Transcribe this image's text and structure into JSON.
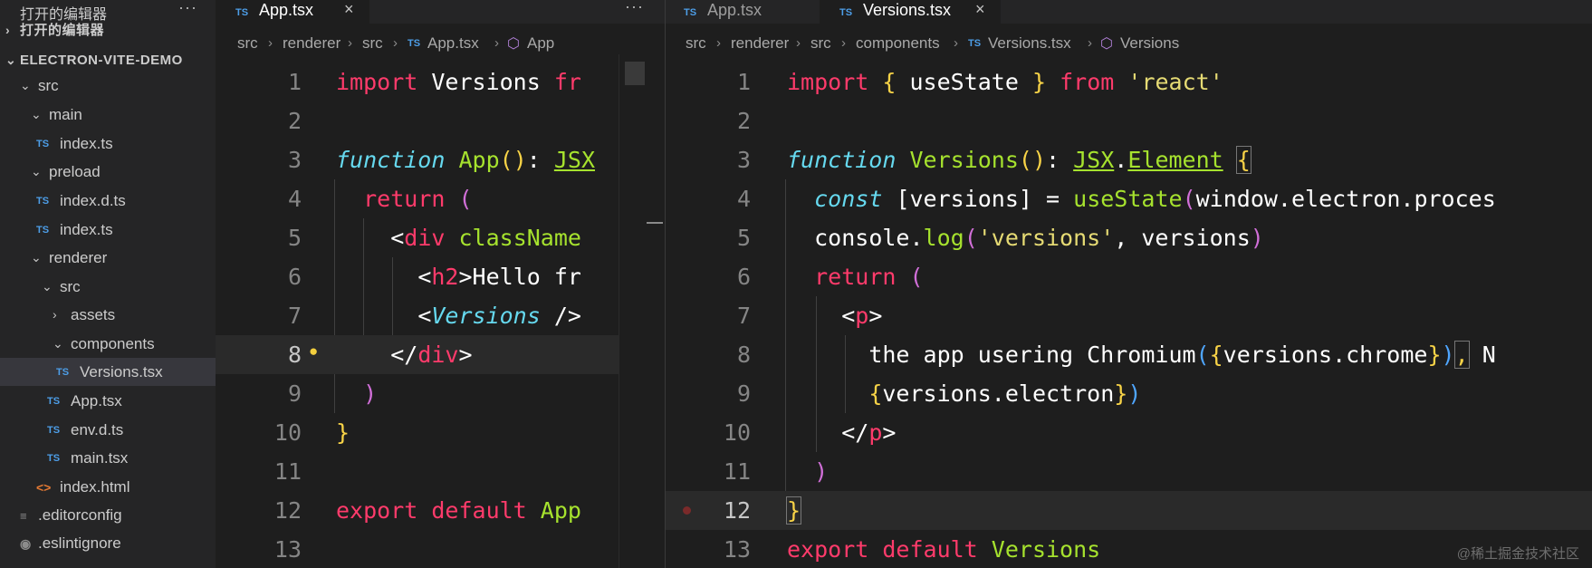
{
  "sidebar": {
    "section_title": "打开的编辑器",
    "more_label": "···",
    "rows": [
      {
        "chevron": "›",
        "label": "打开的编辑器",
        "bold": true
      },
      {
        "chevron": "⌄",
        "label": "ELECTRON-VITE-DEMO",
        "bold": true
      },
      {
        "chevron": "⌄",
        "label": "src"
      },
      {
        "chevron": "⌄",
        "label": "main"
      },
      {
        "icon": "TS",
        "label": "index.ts"
      },
      {
        "chevron": "⌄",
        "label": "preload"
      },
      {
        "icon": "TS",
        "label": "index.d.ts"
      },
      {
        "icon": "TS",
        "label": "index.ts"
      },
      {
        "chevron": "⌄",
        "label": "renderer"
      },
      {
        "chevron": "⌄",
        "label": "src"
      },
      {
        "chevron": "›",
        "label": "assets"
      },
      {
        "chevron": "⌄",
        "label": "components"
      },
      {
        "icon": "TS",
        "label": "Versions.tsx"
      },
      {
        "icon": "TS",
        "label": "App.tsx"
      },
      {
        "icon": "TS",
        "label": "env.d.ts"
      },
      {
        "icon": "TS",
        "label": "main.tsx"
      },
      {
        "icon": "<>",
        "label": "index.html"
      },
      {
        "icon": "≡",
        "label": ".editorconfig"
      },
      {
        "icon": "◉",
        "label": ".eslintignore"
      }
    ]
  },
  "left_group": {
    "tab": {
      "icon": "TS",
      "label": "App.tsx",
      "close": "×"
    },
    "more_label": "···",
    "breadcrumb": [
      "src",
      "renderer",
      "src",
      "App.tsx",
      "App"
    ],
    "line_numbers": [
      "1",
      "2",
      "3",
      "4",
      "5",
      "6",
      "7",
      "8",
      "9",
      "10",
      "11",
      "12",
      "13"
    ]
  },
  "right_group": {
    "tabs": [
      {
        "icon": "TS",
        "label": "App.tsx"
      },
      {
        "icon": "TS",
        "label": "Versions.tsx",
        "close": "×"
      }
    ],
    "breadcrumb": [
      "src",
      "renderer",
      "src",
      "components",
      "Versions.tsx",
      "Versions"
    ],
    "line_numbers": [
      "1",
      "2",
      "3",
      "4",
      "5",
      "6",
      "7",
      "8",
      "9",
      "10",
      "11",
      "12",
      "13"
    ]
  },
  "watermark": "@稀土掘金技术社区",
  "colors": {
    "keyword": "#ff3b6b",
    "function": "#a6e22e",
    "storage_italic": "#66d9ef",
    "string": "#e6db74",
    "bracket": "#f8d347",
    "editor_bg": "#1e1e1e",
    "sidebar_bg": "#252526"
  }
}
